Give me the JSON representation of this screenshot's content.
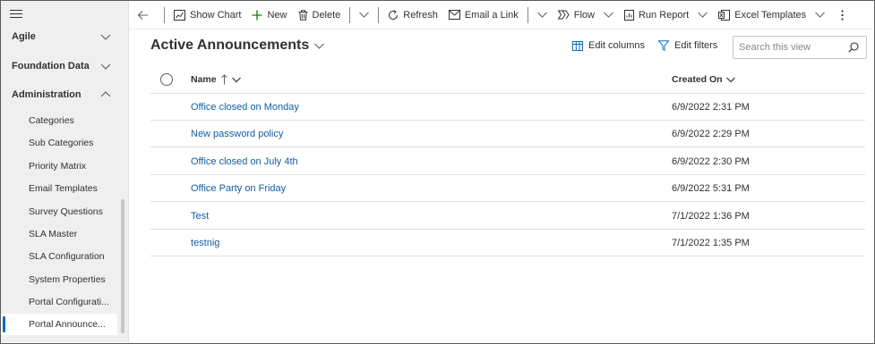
{
  "sidebar": {
    "groups": [
      {
        "label": "Agile",
        "expanded": false
      },
      {
        "label": "Foundation Data",
        "expanded": false
      },
      {
        "label": "Administration",
        "expanded": true
      }
    ],
    "items": [
      {
        "label": "Categories"
      },
      {
        "label": "Sub Categories"
      },
      {
        "label": "Priority Matrix"
      },
      {
        "label": "Email Templates"
      },
      {
        "label": "Survey Questions"
      },
      {
        "label": "SLA Master"
      },
      {
        "label": "SLA Configuration"
      },
      {
        "label": "System Properties"
      },
      {
        "label": "Portal Configurati..."
      },
      {
        "label": "Portal Announce...",
        "active": true
      }
    ]
  },
  "toolbar": {
    "show_chart": "Show Chart",
    "new": "New",
    "delete": "Delete",
    "refresh": "Refresh",
    "email_link": "Email a Link",
    "flow": "Flow",
    "run_report": "Run Report",
    "excel_templates": "Excel Templates"
  },
  "view": {
    "title": "Active Announcements",
    "edit_columns": "Edit columns",
    "edit_filters": "Edit filters",
    "search_placeholder": "Search this view"
  },
  "grid": {
    "columns": {
      "name": "Name",
      "created_on": "Created On"
    },
    "rows": [
      {
        "name": "Office closed on Monday",
        "created_on": "6/9/2022 2:31 PM"
      },
      {
        "name": "New password policy",
        "created_on": "6/9/2022 2:29 PM"
      },
      {
        "name": "Office closed on July 4th",
        "created_on": "6/9/2022 2:30 PM"
      },
      {
        "name": "Office Party on Friday",
        "created_on": "6/9/2022 5:31 PM"
      },
      {
        "name": "Test",
        "created_on": "7/1/2022 1:36 PM"
      },
      {
        "name": "testnig",
        "created_on": "7/1/2022 1:35 PM"
      }
    ]
  },
  "colors": {
    "accent": "#0f6cbd",
    "link": "#115ea3",
    "sidebar_bg": "#efefef",
    "new_plus": "#107c10"
  }
}
